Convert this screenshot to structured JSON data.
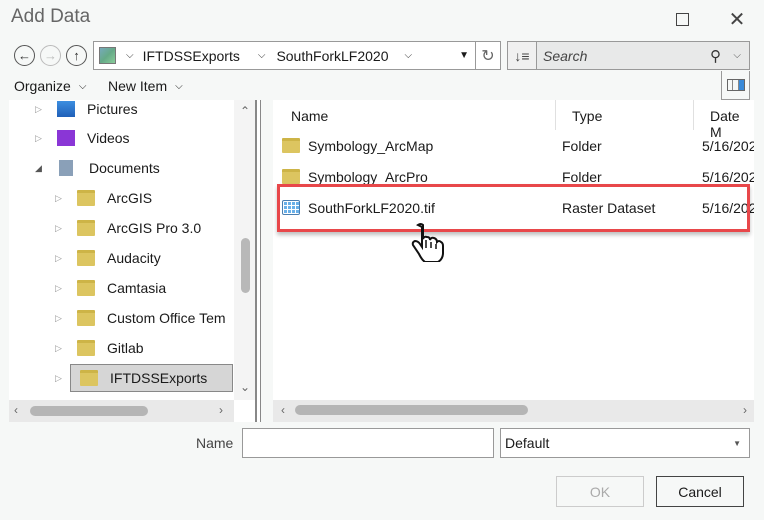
{
  "window": {
    "title": "Add Data"
  },
  "address": {
    "crumbs": [
      "IFTDSSExports",
      "SouthForkLF2020"
    ]
  },
  "search": {
    "placeholder": "Search"
  },
  "toolbar": {
    "organize": "Organize",
    "new_item": "New Item"
  },
  "tree": {
    "items": [
      {
        "label": "Pictures",
        "icon": "pictures-icon",
        "level": 1,
        "expanded": false
      },
      {
        "label": "Videos",
        "icon": "videos-icon",
        "level": 1,
        "expanded": false
      },
      {
        "label": "Documents",
        "icon": "documents-icon",
        "level": 1,
        "expanded": true
      },
      {
        "label": "ArcGIS",
        "icon": "folder-icon",
        "level": 2,
        "expanded": false
      },
      {
        "label": "ArcGIS Pro 3.0",
        "icon": "folder-icon",
        "level": 2,
        "expanded": false
      },
      {
        "label": "Audacity",
        "icon": "folder-icon",
        "level": 2,
        "expanded": false
      },
      {
        "label": "Camtasia",
        "icon": "folder-icon",
        "level": 2,
        "expanded": false
      },
      {
        "label": "Custom Office Tem",
        "icon": "folder-icon",
        "level": 2,
        "expanded": false
      },
      {
        "label": "Gitlab",
        "icon": "folder-icon",
        "level": 2,
        "expanded": false
      },
      {
        "label": "IFTDSSExports",
        "icon": "folder-icon",
        "level": 2,
        "expanded": false,
        "selected": true
      }
    ]
  },
  "list": {
    "columns": [
      "Name",
      "Type",
      "Date M"
    ],
    "rows": [
      {
        "name": "Symbology_ArcMap",
        "type": "Folder",
        "date": "5/16/202",
        "icon": "folder-icon"
      },
      {
        "name": "Symbology_ArcPro",
        "type": "Folder",
        "date": "5/16/202",
        "icon": "folder-icon"
      },
      {
        "name": "SouthForkLF2020.tif",
        "type": "Raster Dataset",
        "date": "5/16/202",
        "icon": "raster-icon",
        "highlighted": true
      }
    ]
  },
  "footer": {
    "name_label": "Name",
    "name_value": "",
    "filter_value": "Default",
    "ok_label": "OK",
    "cancel_label": "Cancel"
  },
  "colors": {
    "highlight": "#e8474a",
    "folder": "#dcc560"
  }
}
